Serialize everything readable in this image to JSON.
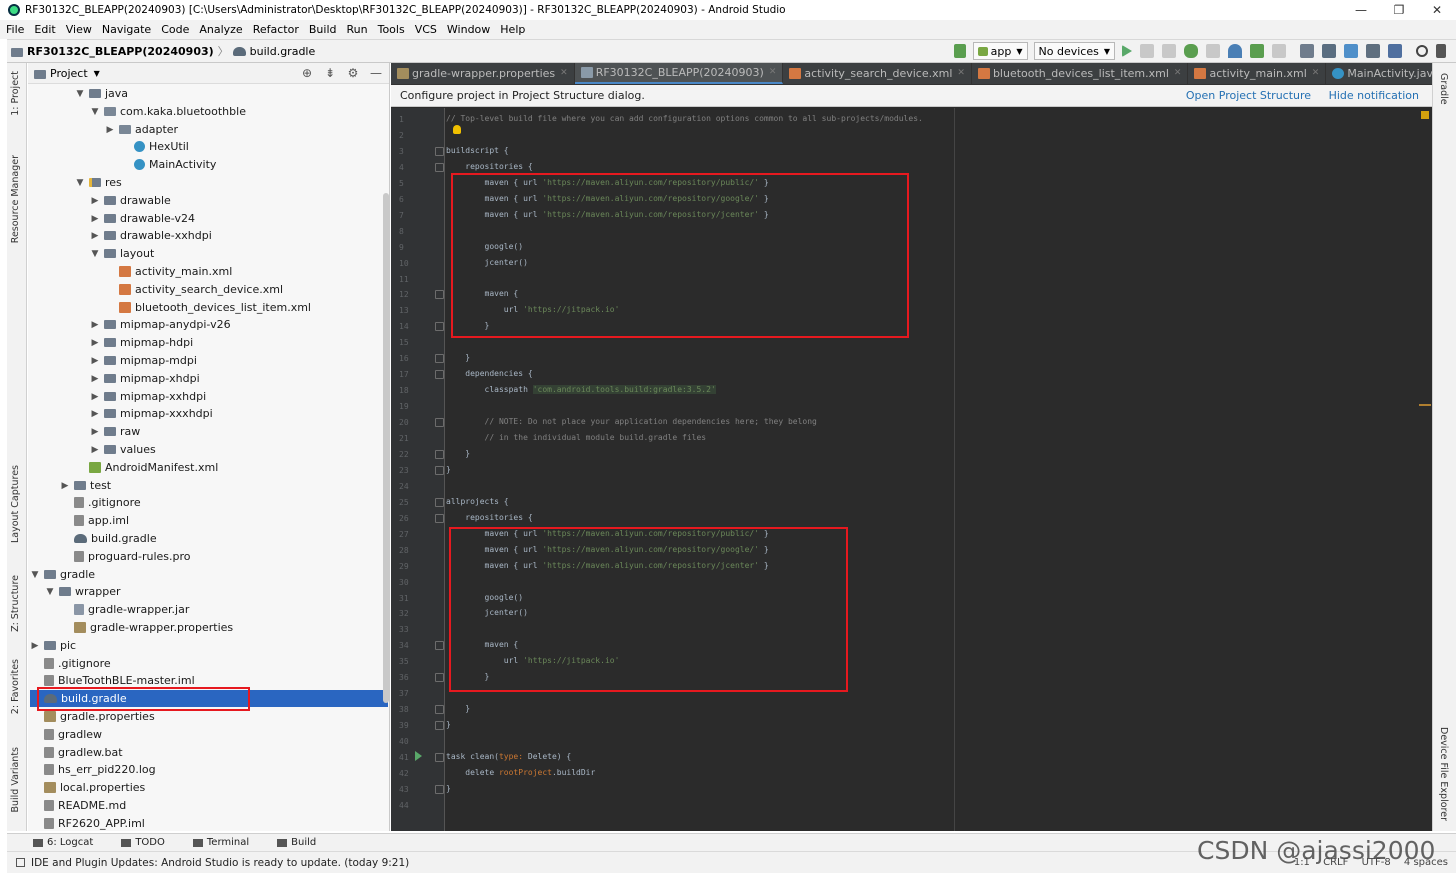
{
  "window": {
    "title": "RF30132C_BLEAPP(20240903) [C:\\Users\\Administrator\\Desktop\\RF30132C_BLEAPP(20240903)] - RF30132C_BLEAPP(20240903) - Android Studio",
    "controls": [
      "—",
      "❐",
      "✕"
    ]
  },
  "menu": [
    "File",
    "Edit",
    "View",
    "Navigate",
    "Code",
    "Analyze",
    "Refactor",
    "Build",
    "Run",
    "Tools",
    "VCS",
    "Window",
    "Help"
  ],
  "breadcrumb": {
    "project": "RF30132C_BLEAPP(20240903)",
    "file": "build.gradle"
  },
  "toolbar": {
    "config": "app",
    "device": "No devices"
  },
  "left_strip": [
    "1: Project",
    "Resource Manager",
    "Layout Captures",
    "Z: Structure",
    "2: Favorites",
    "Build Variants"
  ],
  "right_strip": [
    "Gradle",
    "Device File Explorer"
  ],
  "project_panel": {
    "title": "Project",
    "tree": [
      {
        "label": "java",
        "depth": 4,
        "icon": "folder",
        "expand": "open"
      },
      {
        "label": "com.kaka.bluetoothble",
        "depth": 5,
        "icon": "pkg",
        "expand": "open"
      },
      {
        "label": "adapter",
        "depth": 6,
        "icon": "pkg",
        "expand": "closed"
      },
      {
        "label": "HexUtil",
        "depth": 7,
        "icon": "java",
        "expand": ""
      },
      {
        "label": "MainActivity",
        "depth": 7,
        "icon": "java",
        "expand": ""
      },
      {
        "label": "res",
        "depth": 4,
        "icon": "res",
        "expand": "open"
      },
      {
        "label": "drawable",
        "depth": 5,
        "icon": "folder",
        "expand": "closed"
      },
      {
        "label": "drawable-v24",
        "depth": 5,
        "icon": "folder",
        "expand": "closed"
      },
      {
        "label": "drawable-xxhdpi",
        "depth": 5,
        "icon": "folder",
        "expand": "closed"
      },
      {
        "label": "layout",
        "depth": 5,
        "icon": "folder",
        "expand": "open"
      },
      {
        "label": "activity_main.xml",
        "depth": 6,
        "icon": "xml",
        "expand": ""
      },
      {
        "label": "activity_search_device.xml",
        "depth": 6,
        "icon": "xml",
        "expand": ""
      },
      {
        "label": "bluetooth_devices_list_item.xml",
        "depth": 6,
        "icon": "xml",
        "expand": ""
      },
      {
        "label": "mipmap-anydpi-v26",
        "depth": 5,
        "icon": "folder",
        "expand": "closed"
      },
      {
        "label": "mipmap-hdpi",
        "depth": 5,
        "icon": "folder",
        "expand": "closed"
      },
      {
        "label": "mipmap-mdpi",
        "depth": 5,
        "icon": "folder",
        "expand": "closed"
      },
      {
        "label": "mipmap-xhdpi",
        "depth": 5,
        "icon": "folder",
        "expand": "closed"
      },
      {
        "label": "mipmap-xxhdpi",
        "depth": 5,
        "icon": "folder",
        "expand": "closed"
      },
      {
        "label": "mipmap-xxxhdpi",
        "depth": 5,
        "icon": "folder",
        "expand": "closed"
      },
      {
        "label": "raw",
        "depth": 5,
        "icon": "folder",
        "expand": "closed"
      },
      {
        "label": "values",
        "depth": 5,
        "icon": "folder",
        "expand": "closed"
      },
      {
        "label": "AndroidManifest.xml",
        "depth": 4,
        "icon": "manifest",
        "expand": ""
      },
      {
        "label": "test",
        "depth": 3,
        "icon": "folder",
        "expand": "closed"
      },
      {
        "label": ".gitignore",
        "depth": 3,
        "icon": "file",
        "expand": ""
      },
      {
        "label": "app.iml",
        "depth": 3,
        "icon": "file",
        "expand": ""
      },
      {
        "label": "build.gradle",
        "depth": 3,
        "icon": "gradle",
        "expand": ""
      },
      {
        "label": "proguard-rules.pro",
        "depth": 3,
        "icon": "file",
        "expand": ""
      },
      {
        "label": "gradle",
        "depth": 1,
        "icon": "folder",
        "expand": "open"
      },
      {
        "label": "wrapper",
        "depth": 2,
        "icon": "folder",
        "expand": "open"
      },
      {
        "label": "gradle-wrapper.jar",
        "depth": 3,
        "icon": "jar",
        "expand": ""
      },
      {
        "label": "gradle-wrapper.properties",
        "depth": 3,
        "icon": "props",
        "expand": ""
      },
      {
        "label": "pic",
        "depth": 1,
        "icon": "folder",
        "expand": "closed"
      },
      {
        "label": ".gitignore",
        "depth": 1,
        "icon": "file",
        "expand": ""
      },
      {
        "label": "BlueToothBLE-master.iml",
        "depth": 1,
        "icon": "file",
        "expand": ""
      },
      {
        "label": "build.gradle",
        "depth": 1,
        "icon": "gradle",
        "expand": "",
        "selected": true
      },
      {
        "label": "gradle.properties",
        "depth": 1,
        "icon": "props",
        "expand": ""
      },
      {
        "label": "gradlew",
        "depth": 1,
        "icon": "file",
        "expand": ""
      },
      {
        "label": "gradlew.bat",
        "depth": 1,
        "icon": "file",
        "expand": ""
      },
      {
        "label": "hs_err_pid220.log",
        "depth": 1,
        "icon": "file",
        "expand": ""
      },
      {
        "label": "local.properties",
        "depth": 1,
        "icon": "props",
        "expand": ""
      },
      {
        "label": "README.md",
        "depth": 1,
        "icon": "file",
        "expand": ""
      },
      {
        "label": "RF2620_APP.iml",
        "depth": 1,
        "icon": "file",
        "expand": ""
      }
    ]
  },
  "tabs": [
    {
      "label": "gradle-wrapper.properties",
      "icon": "props",
      "active": false
    },
    {
      "label": "RF30132C_BLEAPP(20240903)",
      "icon": "gradle",
      "active": true
    },
    {
      "label": "activity_search_device.xml",
      "icon": "xml",
      "active": false
    },
    {
      "label": "bluetooth_devices_list_item.xml",
      "icon": "xml",
      "active": false
    },
    {
      "label": "activity_main.xml",
      "icon": "xml",
      "active": false
    },
    {
      "label": "MainActivity.java",
      "icon": "java",
      "active": false
    }
  ],
  "notification": {
    "text": "Configure project in Project Structure dialog.",
    "link1": "Open Project Structure",
    "link2": "Hide notification"
  },
  "code_lines": [
    {
      "n": "1",
      "segs": [
        {
          "t": "// Top-level build file where you can add configuration options common to all sub-projects/modules.",
          "c": "cm"
        }
      ]
    },
    {
      "n": "2",
      "segs": []
    },
    {
      "n": "3",
      "segs": [
        {
          "t": "buildscript {",
          "c": ""
        }
      ]
    },
    {
      "n": "4",
      "segs": [
        {
          "t": "    repositories {",
          "c": ""
        }
      ]
    },
    {
      "n": "5",
      "segs": [
        {
          "t": "        maven { url ",
          "c": ""
        },
        {
          "t": "'https://maven.aliyun.com/repository/public/'",
          "c": "st"
        },
        {
          "t": " }",
          "c": ""
        }
      ]
    },
    {
      "n": "6",
      "segs": [
        {
          "t": "        maven { url ",
          "c": ""
        },
        {
          "t": "'https://maven.aliyun.com/repository/google/'",
          "c": "st"
        },
        {
          "t": " }",
          "c": ""
        }
      ]
    },
    {
      "n": "7",
      "segs": [
        {
          "t": "        maven { url ",
          "c": ""
        },
        {
          "t": "'https://maven.aliyun.com/repository/jcenter'",
          "c": "st"
        },
        {
          "t": " }",
          "c": ""
        }
      ]
    },
    {
      "n": "8",
      "segs": []
    },
    {
      "n": "9",
      "segs": [
        {
          "t": "        google()",
          "c": ""
        }
      ]
    },
    {
      "n": "10",
      "segs": [
        {
          "t": "        jcenter()",
          "c": ""
        }
      ]
    },
    {
      "n": "11",
      "segs": []
    },
    {
      "n": "12",
      "segs": [
        {
          "t": "        maven {",
          "c": ""
        }
      ]
    },
    {
      "n": "13",
      "segs": [
        {
          "t": "            url ",
          "c": ""
        },
        {
          "t": "'https://jitpack.io'",
          "c": "st"
        }
      ]
    },
    {
      "n": "14",
      "segs": [
        {
          "t": "        }",
          "c": ""
        }
      ]
    },
    {
      "n": "15",
      "segs": []
    },
    {
      "n": "16",
      "segs": [
        {
          "t": "    }",
          "c": ""
        }
      ]
    },
    {
      "n": "17",
      "segs": [
        {
          "t": "    dependencies {",
          "c": ""
        }
      ]
    },
    {
      "n": "18",
      "segs": [
        {
          "t": "        classpath ",
          "c": ""
        },
        {
          "t": "'com.android.tools.build:gradle:3.5.2'",
          "c": "hl"
        }
      ]
    },
    {
      "n": "19",
      "segs": []
    },
    {
      "n": "20",
      "segs": [
        {
          "t": "        // NOTE: Do not place your application dependencies here; they belong",
          "c": "cm"
        }
      ]
    },
    {
      "n": "21",
      "segs": [
        {
          "t": "        // in the individual module build.gradle files",
          "c": "cm"
        }
      ]
    },
    {
      "n": "22",
      "segs": [
        {
          "t": "    }",
          "c": ""
        }
      ]
    },
    {
      "n": "23",
      "segs": [
        {
          "t": "}",
          "c": ""
        }
      ]
    },
    {
      "n": "24",
      "segs": []
    },
    {
      "n": "25",
      "segs": [
        {
          "t": "allprojects {",
          "c": ""
        }
      ]
    },
    {
      "n": "26",
      "segs": [
        {
          "t": "    repositories {",
          "c": ""
        }
      ]
    },
    {
      "n": "27",
      "segs": [
        {
          "t": "        maven { url ",
          "c": ""
        },
        {
          "t": "'https://maven.aliyun.com/repository/public/'",
          "c": "st"
        },
        {
          "t": " }",
          "c": ""
        }
      ]
    },
    {
      "n": "28",
      "segs": [
        {
          "t": "        maven { url ",
          "c": ""
        },
        {
          "t": "'https://maven.aliyun.com/repository/google/'",
          "c": "st"
        },
        {
          "t": " }",
          "c": ""
        }
      ]
    },
    {
      "n": "29",
      "segs": [
        {
          "t": "        maven { url ",
          "c": ""
        },
        {
          "t": "'https://maven.aliyun.com/repository/jcenter'",
          "c": "st"
        },
        {
          "t": " }",
          "c": ""
        }
      ]
    },
    {
      "n": "30",
      "segs": []
    },
    {
      "n": "31",
      "segs": [
        {
          "t": "        google()",
          "c": ""
        }
      ]
    },
    {
      "n": "32",
      "segs": [
        {
          "t": "        jcenter()",
          "c": ""
        }
      ]
    },
    {
      "n": "33",
      "segs": []
    },
    {
      "n": "34",
      "segs": [
        {
          "t": "        maven {",
          "c": ""
        }
      ]
    },
    {
      "n": "35",
      "segs": [
        {
          "t": "            url ",
          "c": ""
        },
        {
          "t": "'https://jitpack.io'",
          "c": "st"
        }
      ]
    },
    {
      "n": "36",
      "segs": [
        {
          "t": "        }",
          "c": ""
        }
      ]
    },
    {
      "n": "37",
      "segs": []
    },
    {
      "n": "38",
      "segs": [
        {
          "t": "    }",
          "c": ""
        }
      ]
    },
    {
      "n": "39",
      "segs": [
        {
          "t": "}",
          "c": ""
        }
      ]
    },
    {
      "n": "40",
      "segs": []
    },
    {
      "n": "41",
      "segs": [
        {
          "t": "task clean(",
          "c": ""
        },
        {
          "t": "type:",
          "c": "kw"
        },
        {
          "t": " Delete) {",
          "c": ""
        }
      ]
    },
    {
      "n": "42",
      "segs": [
        {
          "t": "    delete ",
          "c": ""
        },
        {
          "t": "rootProject",
          "c": "kw"
        },
        {
          "t": ".buildDir",
          "c": ""
        }
      ]
    },
    {
      "n": "43",
      "segs": [
        {
          "t": "}",
          "c": ""
        }
      ]
    },
    {
      "n": "44",
      "segs": []
    }
  ],
  "bottom_tools": [
    "6: Logcat",
    "TODO",
    "Terminal",
    "Build"
  ],
  "status": {
    "message": "IDE and Plugin Updates: Android Studio is ready to update. (today 9:21)",
    "right": [
      "1:1",
      "CRLF",
      "UTF-8",
      "4 spaces"
    ]
  },
  "watermark": "CSDN @ajassi2000",
  "colors": {
    "editor_bg": "#2b2b2b",
    "annotation_red": "#e6191f",
    "link_blue": "#2470b3"
  }
}
